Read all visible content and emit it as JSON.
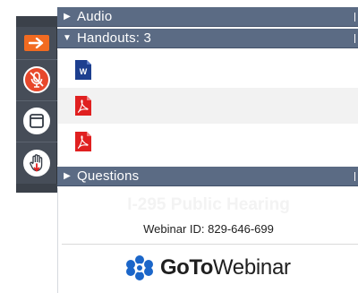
{
  "sections": {
    "audio": {
      "label": "Audio",
      "expanded": false
    },
    "handouts": {
      "label": "Handouts: 3",
      "expanded": true
    },
    "questions": {
      "label": "Questions",
      "expanded": false
    }
  },
  "handouts": [
    {
      "type": "word-document-icon",
      "glyph": "W",
      "color": "#1d3f8f"
    },
    {
      "type": "pdf-document-icon",
      "color": "#e02020"
    },
    {
      "type": "pdf-document-icon",
      "color": "#e02020"
    }
  ],
  "toolbar": {
    "items": [
      {
        "icon": "arrow-right-icon",
        "color": "#f26b21"
      },
      {
        "icon": "microphone-muted-icon",
        "color": "#e8482b"
      },
      {
        "icon": "window-icon",
        "color": "#ffffff"
      },
      {
        "icon": "raise-hand-icon",
        "color": "#ffffff"
      }
    ]
  },
  "event": {
    "title": "I-295 Public Hearing",
    "webinar_id": "Webinar ID: 829-646-699"
  },
  "brand": {
    "goto": "GoTo",
    "webinar": "Webinar",
    "logo_color": "#1b66c9"
  }
}
